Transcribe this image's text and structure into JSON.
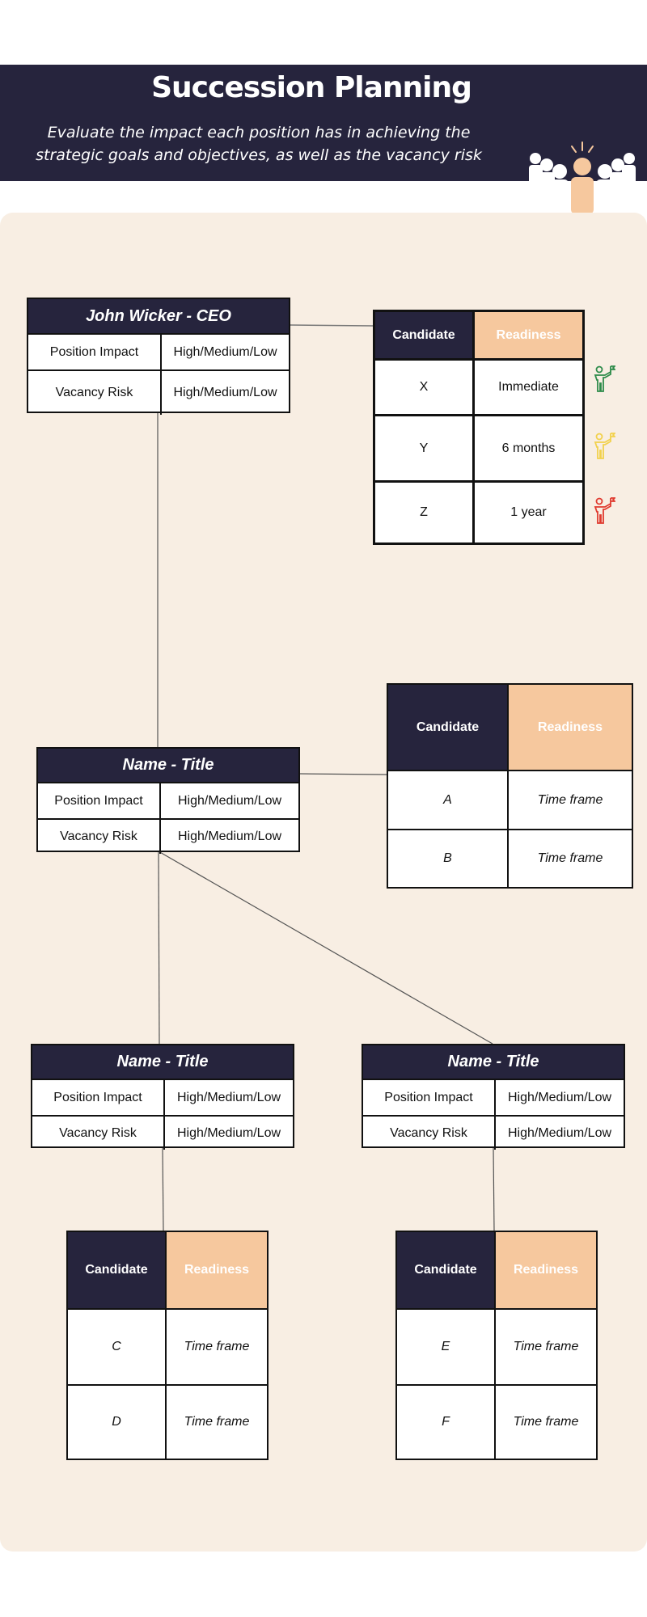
{
  "header": {
    "title": "Succession Planning",
    "subtitle": "Evaluate the impact each position has in achieving the strategic goals and objectives, as well as the vacancy risk",
    "icon": "team-people-icon"
  },
  "colors": {
    "navy": "#26243d",
    "peach": "#f6c89e",
    "panel": "#f8eee3",
    "ready_now": "#2e8b4a",
    "ready_6m": "#f2d14c",
    "ready_1y": "#e03a2f"
  },
  "positions": [
    {
      "title": "John Wicker - CEO",
      "rows": [
        {
          "label": "Position Impact",
          "value": "High/Medium/Low"
        },
        {
          "label": "Vacancy Risk",
          "value": "High/Medium/Low"
        }
      ]
    },
    {
      "title": "Name - Title",
      "rows": [
        {
          "label": "Position Impact",
          "value": "High/Medium/Low"
        },
        {
          "label": "Vacancy Risk",
          "value": "High/Medium/Low"
        }
      ]
    },
    {
      "title": "Name - Title",
      "rows": [
        {
          "label": "Position Impact",
          "value": "High/Medium/Low"
        },
        {
          "label": "Vacancy Risk",
          "value": "High/Medium/Low"
        }
      ]
    },
    {
      "title": "Name - Title",
      "rows": [
        {
          "label": "Position Impact",
          "value": "High/Medium/Low"
        },
        {
          "label": "Vacancy Risk",
          "value": "High/Medium/Low"
        }
      ]
    }
  ],
  "candidate_tables": [
    {
      "headers": [
        "Candidate",
        "Readiness"
      ],
      "rows": [
        [
          "X",
          "Immediate"
        ],
        [
          "Y",
          "6 months"
        ],
        [
          "Z",
          "1 year"
        ]
      ],
      "status_icons": [
        "person-flag-green-icon",
        "person-flag-yellow-icon",
        "person-flag-red-icon"
      ]
    },
    {
      "headers": [
        "Candidate",
        "Readiness"
      ],
      "rows": [
        [
          "A",
          "Time frame"
        ],
        [
          "B",
          "Time frame"
        ]
      ]
    },
    {
      "headers": [
        "Candidate",
        "Readiness"
      ],
      "rows": [
        [
          "C",
          "Time frame"
        ],
        [
          "D",
          "Time frame"
        ]
      ]
    },
    {
      "headers": [
        "Candidate",
        "Readiness"
      ],
      "rows": [
        [
          "E",
          "Time frame"
        ],
        [
          "F",
          "Time frame"
        ]
      ]
    }
  ]
}
